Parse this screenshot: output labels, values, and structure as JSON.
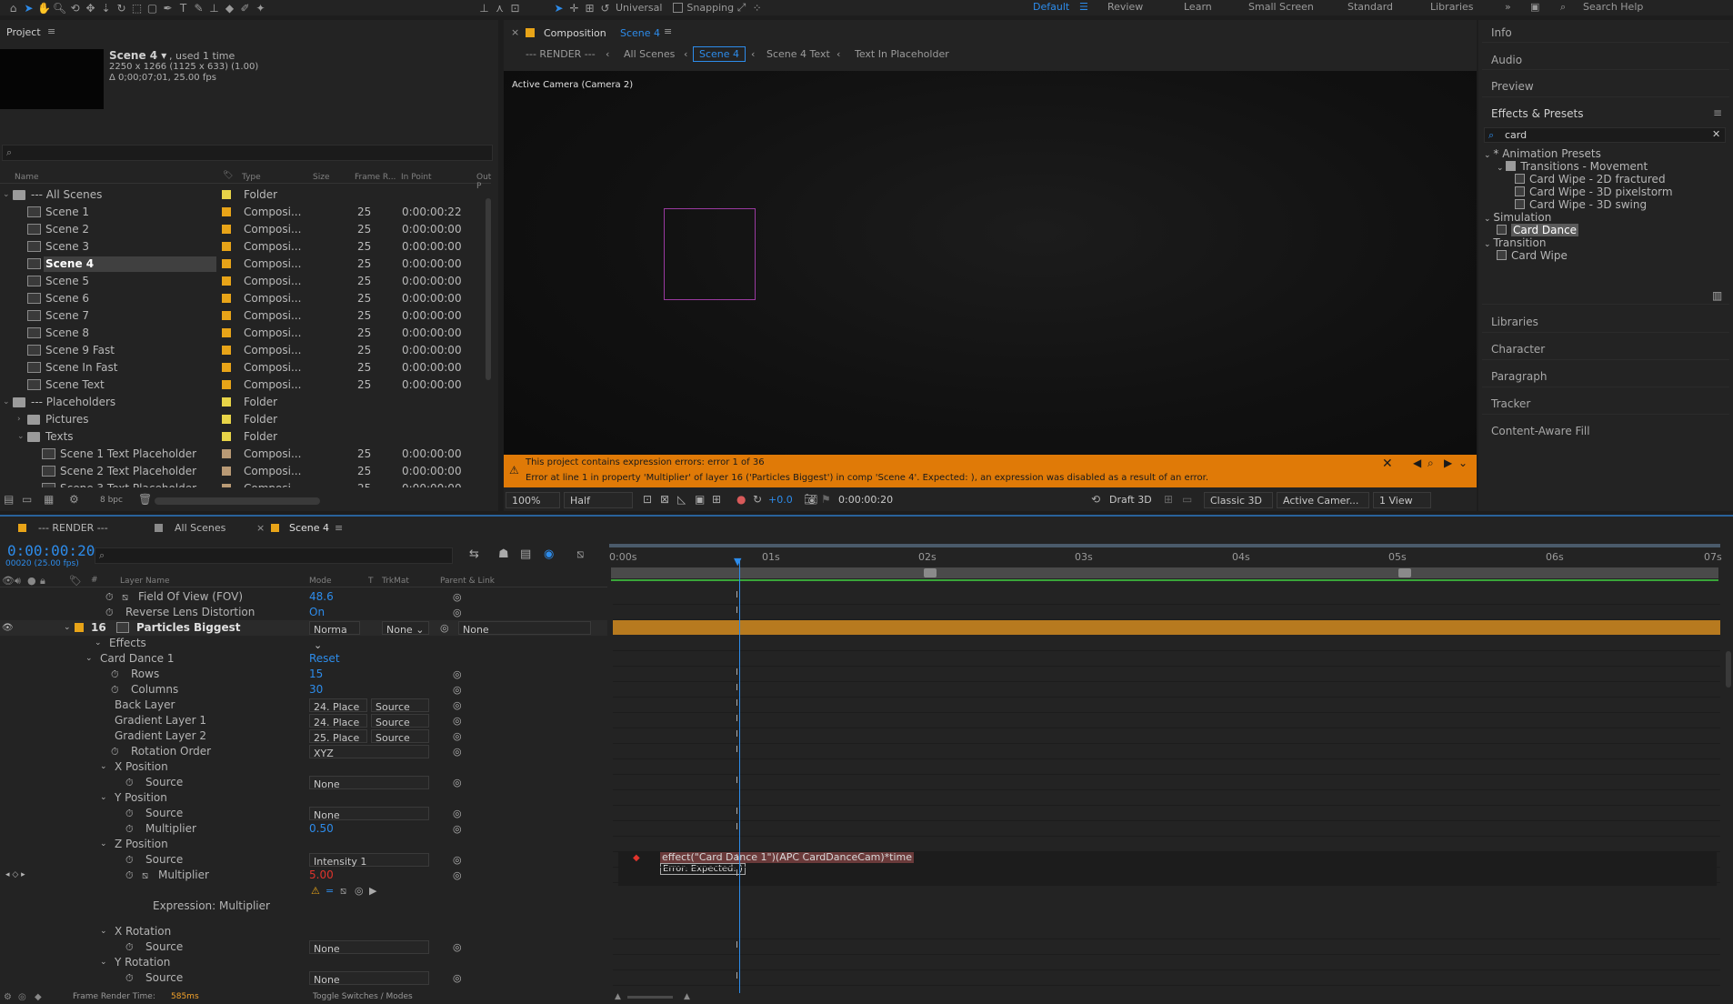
{
  "toolbar": {
    "universal": "Universal",
    "snapping": "Snapping",
    "workspaces": [
      "Default",
      "Review",
      "Learn",
      "Small Screen",
      "Standard",
      "Libraries"
    ],
    "active_workspace": "Default",
    "search_help": "Search Help"
  },
  "project": {
    "title": "Project",
    "comp_name": "Scene 4 ▾",
    "used": ", used 1 time",
    "dims": "2250 x 1266  (1125 x 633) (1.00)",
    "duration": "Δ 0;00;07;01, 25.00 fps",
    "bpc": "8 bpc",
    "columns": [
      "Name",
      "Type",
      "Size",
      "Frame R...",
      "In Point",
      "Out P"
    ],
    "items": [
      {
        "name": "--- All Scenes",
        "type": "Folder",
        "fr": "",
        "in": "",
        "kind": "folder",
        "indent": 0,
        "open": true
      },
      {
        "name": "Scene 1",
        "type": "Composi...",
        "fr": "25",
        "in": "0:00:00:22",
        "kind": "comp",
        "indent": 1
      },
      {
        "name": "Scene 2",
        "type": "Composi...",
        "fr": "25",
        "in": "0:00:00:00",
        "kind": "comp",
        "indent": 1
      },
      {
        "name": "Scene 3",
        "type": "Composi...",
        "fr": "25",
        "in": "0:00:00:00",
        "kind": "comp",
        "indent": 1
      },
      {
        "name": "Scene 4",
        "type": "Composi...",
        "fr": "25",
        "in": "0:00:00:00",
        "kind": "comp",
        "indent": 1,
        "selected": true
      },
      {
        "name": "Scene 5",
        "type": "Composi...",
        "fr": "25",
        "in": "0:00:00:00",
        "kind": "comp",
        "indent": 1
      },
      {
        "name": "Scene 6",
        "type": "Composi...",
        "fr": "25",
        "in": "0:00:00:00",
        "kind": "comp",
        "indent": 1
      },
      {
        "name": "Scene 7",
        "type": "Composi...",
        "fr": "25",
        "in": "0:00:00:00",
        "kind": "comp",
        "indent": 1
      },
      {
        "name": "Scene 8",
        "type": "Composi...",
        "fr": "25",
        "in": "0:00:00:00",
        "kind": "comp",
        "indent": 1
      },
      {
        "name": "Scene 9 Fast",
        "type": "Composi...",
        "fr": "25",
        "in": "0:00:00:00",
        "kind": "comp",
        "indent": 1
      },
      {
        "name": "Scene In Fast",
        "type": "Composi...",
        "fr": "25",
        "in": "0:00:00:00",
        "kind": "comp",
        "indent": 1
      },
      {
        "name": "Scene Text",
        "type": "Composi...",
        "fr": "25",
        "in": "0:00:00:00",
        "kind": "comp",
        "indent": 1
      },
      {
        "name": "--- Placeholders",
        "type": "Folder",
        "fr": "",
        "in": "",
        "kind": "folder",
        "indent": 0,
        "open": true
      },
      {
        "name": "Pictures",
        "type": "Folder",
        "fr": "",
        "in": "",
        "kind": "folder",
        "indent": 1
      },
      {
        "name": "Texts",
        "type": "Folder",
        "fr": "",
        "in": "",
        "kind": "folder",
        "indent": 1,
        "open": true
      },
      {
        "name": "Scene 1 Text Placeholder",
        "type": "Composi...",
        "fr": "25",
        "in": "0:00:00:00",
        "kind": "pl",
        "indent": 2
      },
      {
        "name": "Scene 2 Text Placeholder",
        "type": "Composi...",
        "fr": "25",
        "in": "0:00:00:00",
        "kind": "pl",
        "indent": 2
      },
      {
        "name": "Scene 3 Text Placeholder",
        "type": "Composi...",
        "fr": "25",
        "in": "0:00:00:00",
        "kind": "pl",
        "indent": 2
      }
    ]
  },
  "comp": {
    "tab_label": "Composition",
    "tab_name": "Scene 4",
    "breadcrumbs": [
      "--- RENDER ---",
      "All Scenes",
      "Scene 4",
      "Scene 4 Text",
      "Text In Placeholder"
    ],
    "camera_label": "Active Camera (Camera 2)",
    "warning_line1": "This project contains expression errors: error 1 of 36",
    "warning_line2": "Error at line 1 in property 'Multiplier' of layer 16 ('Particles Biggest') in comp 'Scene 4'.  Expected: ), an expression was disabled as a result of an error.",
    "zoom": "100%",
    "resolution": "Half",
    "exposure": "+0.0",
    "timecode": "0:00:00:20",
    "draft": "Draft 3D",
    "renderer": "Classic 3D",
    "view": "Active Camer...",
    "views": "1 View"
  },
  "right": {
    "panels_top": [
      "Info",
      "Audio",
      "Preview"
    ],
    "effects_title": "Effects & Presets",
    "search_value": "card",
    "tree": [
      {
        "label": "* Animation Presets",
        "level": 0,
        "type": "folder-open"
      },
      {
        "label": "Transitions - Movement",
        "level": 1,
        "type": "folder-open"
      },
      {
        "label": "Card Wipe - 2D fractured",
        "level": 2,
        "type": "preset"
      },
      {
        "label": "Card Wipe - 3D pixelstorm",
        "level": 2,
        "type": "preset"
      },
      {
        "label": "Card Wipe - 3D swing",
        "level": 2,
        "type": "preset"
      },
      {
        "label": "Simulation",
        "level": 0,
        "type": "category"
      },
      {
        "label": "Card Dance",
        "level": 1,
        "type": "effect",
        "selected": true
      },
      {
        "label": "Transition",
        "level": 0,
        "type": "category"
      },
      {
        "label": "Card Wipe",
        "level": 1,
        "type": "effect"
      }
    ],
    "panels_bottom": [
      "Libraries",
      "Character",
      "Paragraph",
      "Tracker",
      "Content-Aware Fill"
    ]
  },
  "timeline": {
    "tabs": [
      "--- RENDER ---",
      "All Scenes",
      "Scene 4"
    ],
    "timecode": "0:00:00:20",
    "timecode_sub": "00020 (25.00 fps)",
    "columns": [
      "Layer Name",
      "Mode",
      "T",
      "TrkMat",
      "Parent & Link"
    ],
    "ruler": [
      "0:00s",
      "01s",
      "02s",
      "03s",
      "04s",
      "05s",
      "06s",
      "07s"
    ],
    "layers": [
      {
        "name": "Field Of View (FOV)",
        "value": "48.6",
        "kind": "prop-graph",
        "indent": 1
      },
      {
        "name": "Reverse Lens Distortion",
        "value": "On",
        "kind": "prop",
        "indent": 1
      },
      {
        "name": "Particles Biggest",
        "num": "16",
        "mode": "Norma",
        "trkmat": "None",
        "parent": "None",
        "kind": "layer"
      },
      {
        "name": "Effects",
        "kind": "group",
        "indent": 1
      },
      {
        "name": "Card Dance 1",
        "value": "Reset",
        "kind": "group",
        "indent": 2
      },
      {
        "name": "Rows",
        "value": "15",
        "kind": "prop",
        "indent": 3
      },
      {
        "name": "Columns",
        "value": "30",
        "kind": "prop",
        "indent": 3
      },
      {
        "name": "Back Layer",
        "value": "24. Place",
        "src": "Source",
        "kind": "layerprop",
        "indent": 3
      },
      {
        "name": "Gradient Layer 1",
        "value": "24. Place",
        "src": "Source",
        "kind": "layerprop",
        "indent": 3
      },
      {
        "name": "Gradient Layer 2",
        "value": "25. Place",
        "src": "Source",
        "kind": "layerprop",
        "indent": 3
      },
      {
        "name": "Rotation Order",
        "value": "XYZ",
        "kind": "dropdown",
        "indent": 3
      },
      {
        "name": "X Position",
        "kind": "group",
        "indent": 3
      },
      {
        "name": "Source",
        "value": "None",
        "kind": "dropdown",
        "indent": 4
      },
      {
        "name": "Y Position",
        "kind": "group",
        "indent": 3
      },
      {
        "name": "Source",
        "value": "None",
        "kind": "dropdown",
        "indent": 4
      },
      {
        "name": "Multiplier",
        "value": "0.50",
        "kind": "prop",
        "indent": 4
      },
      {
        "name": "Z Position",
        "kind": "group",
        "indent": 3
      },
      {
        "name": "Source",
        "value": "Intensity 1",
        "kind": "dropdown",
        "indent": 4
      },
      {
        "name": "Multiplier",
        "value": "5.00",
        "kind": "prop-error",
        "indent": 4
      },
      {
        "name": "",
        "kind": "expr-icons",
        "indent": 4
      },
      {
        "name": "Expression: Multiplier",
        "kind": "label",
        "indent": 3
      },
      {
        "name": "X Rotation",
        "kind": "group",
        "indent": 3
      },
      {
        "name": "Source",
        "value": "None",
        "kind": "dropdown",
        "indent": 4
      },
      {
        "name": "Y Rotation",
        "kind": "group",
        "indent": 3
      },
      {
        "name": "Source",
        "value": "None",
        "kind": "dropdown",
        "indent": 4
      }
    ],
    "expression": "effect(\"Card Dance 1\")(APC CardDanceCam)*time",
    "expression_error": "Error: Expected: )",
    "footer_render_label": "Frame Render Time:",
    "footer_render_value": "585ms",
    "footer_toggle": "Toggle Switches / Modes"
  },
  "colors": {
    "accent": "#2d8ceb",
    "warning": "#e07a07",
    "layer_bar": "#b77a1f",
    "error": "#e0342c"
  }
}
